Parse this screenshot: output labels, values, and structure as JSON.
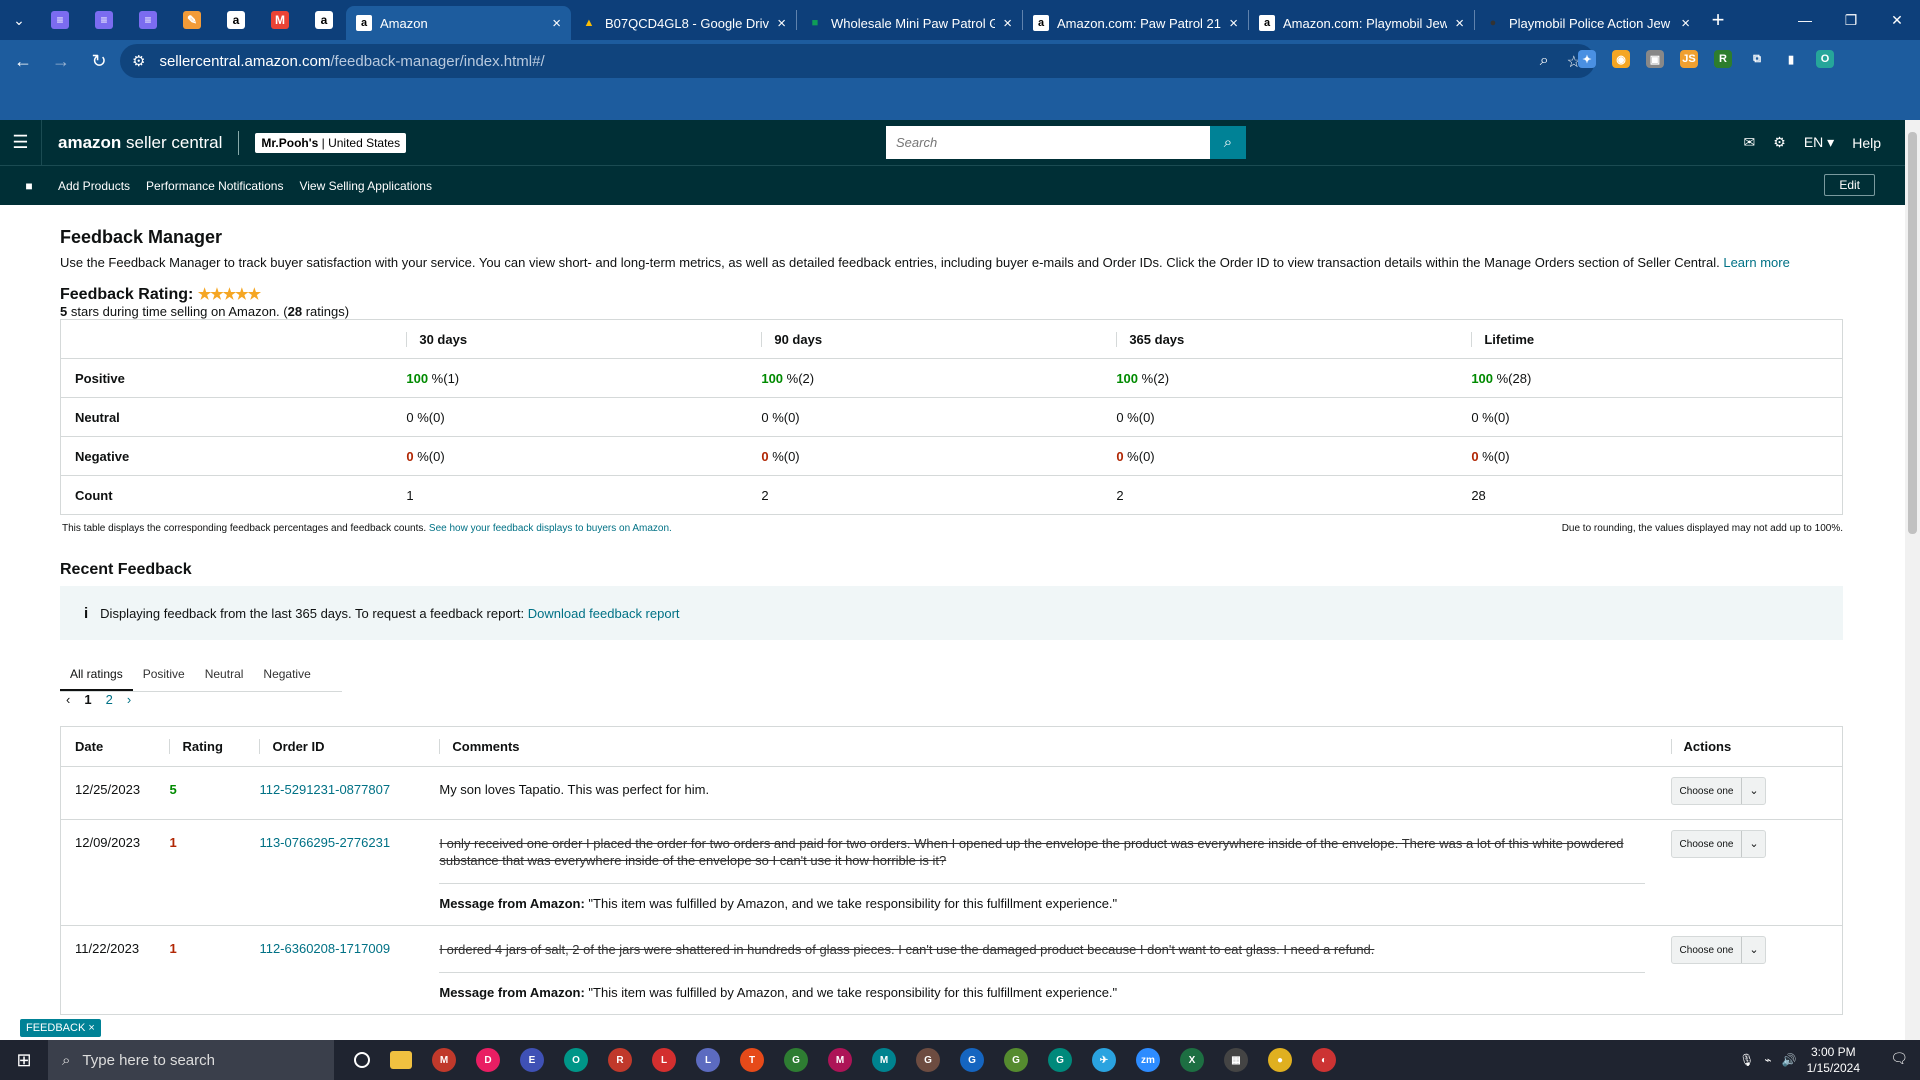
{
  "browser": {
    "pinned_tabs": [
      {
        "icon": "list-icon",
        "color": "#7b6cf0"
      },
      {
        "icon": "list-icon",
        "color": "#7b6cf0"
      },
      {
        "icon": "list-icon",
        "color": "#7b6cf0"
      },
      {
        "icon": "pen-icon",
        "color": "#f29b38"
      },
      {
        "icon": "amazon-icon",
        "color": "#ffffff"
      },
      {
        "icon": "gmail-icon",
        "color": "#ea4335"
      },
      {
        "icon": "amazon-icon",
        "color": "#ffffff"
      }
    ],
    "tabs": [
      {
        "title": "Amazon",
        "active": true,
        "favicon": "a",
        "color": "#ffffff"
      },
      {
        "title": "B07QCD4GL8 - Google Drive",
        "active": false,
        "favicon": "▲",
        "color": "#fbbc04"
      },
      {
        "title": "Wholesale Mini Paw Patrol G",
        "active": false,
        "favicon": "■",
        "color": "#0f9d58"
      },
      {
        "title": "Amazon.com: Paw Patrol 21\"",
        "active": false,
        "favicon": "a",
        "color": "#ffffff"
      },
      {
        "title": "Amazon.com: Playmobil Jew",
        "active": false,
        "favicon": "a",
        "color": "#ffffff"
      },
      {
        "title": "Playmobil Police Action Jew",
        "active": false,
        "favicon": "●",
        "color": "#333333"
      }
    ],
    "url_site": "sellercentral.amazon.com",
    "url_path": "/feedback-manager/index.html#/",
    "extensions": [
      {
        "icon": "puzzle-ext-icon",
        "color": "#4a90e2",
        "glyph": "✦"
      },
      {
        "icon": "orange-ext-icon",
        "color": "#f5a623",
        "glyph": "◉"
      },
      {
        "icon": "image-ext-icon",
        "color": "#888888",
        "glyph": "▣"
      },
      {
        "icon": "js-ext-icon",
        "color": "#f0a030",
        "glyph": "JS"
      },
      {
        "icon": "r-ext-icon",
        "color": "#2d7d2d",
        "glyph": "R"
      },
      {
        "icon": "extensions-icon",
        "color": "#1d5c9e",
        "glyph": "⧉"
      },
      {
        "icon": "sidepanel-icon",
        "color": "#1d5c9e",
        "glyph": "▮"
      },
      {
        "icon": "profile-icon",
        "color": "#26a69a",
        "glyph": "O"
      }
    ]
  },
  "sc": {
    "logo_bold": "amazon",
    "logo_rest": " seller central",
    "account_name": "Mr.Pooh's",
    "account_country": "United States",
    "search_placeholder": "Search",
    "lang": "EN ▾",
    "help": "Help",
    "nav": [
      "Add Products",
      "Performance Notifications",
      "View Selling Applications"
    ],
    "edit": "Edit"
  },
  "page": {
    "title": "Feedback Manager",
    "description": "Use the Feedback Manager to track buyer satisfaction with your service. You can view short- and long-term metrics, as well as detailed feedback entries, including buyer e-mails and Order IDs. Click the Order ID to view transaction details within the Manage Orders section of Seller Central.",
    "learn_more": "Learn more",
    "rating_label": "Feedback Rating:",
    "stars": "★★★★★",
    "rating_sub_bold": "5",
    "rating_sub_text": " stars during time selling on Amazon. (",
    "rating_count": "28",
    "rating_sub_end": " ratings)"
  },
  "metrics": {
    "headers": [
      "30 days",
      "90 days",
      "365 days",
      "Lifetime"
    ],
    "rows": [
      {
        "label": "Positive",
        "cls": "g",
        "cells": [
          [
            "100",
            " %(1)"
          ],
          [
            "100",
            " %(2)"
          ],
          [
            "100",
            " %(2)"
          ],
          [
            "100",
            " %(28)"
          ]
        ]
      },
      {
        "label": "Neutral",
        "cls": "",
        "cells": [
          [
            "0",
            " %(0)"
          ],
          [
            "0",
            " %(0)"
          ],
          [
            "0",
            " %(0)"
          ],
          [
            "0",
            " %(0)"
          ]
        ]
      },
      {
        "label": "Negative",
        "cls": "r",
        "cells": [
          [
            "0",
            " %(0)"
          ],
          [
            "0",
            " %(0)"
          ],
          [
            "0",
            " %(0)"
          ],
          [
            "0",
            " %(0)"
          ]
        ]
      },
      {
        "label": "Count",
        "cls": "",
        "cells": [
          [
            "",
            "1"
          ],
          [
            "",
            "2"
          ],
          [
            "",
            "2"
          ],
          [
            "",
            "28"
          ]
        ]
      }
    ],
    "note_left": "This table displays the corresponding feedback percentages and feedback counts.",
    "note_left_link": "See how your feedback displays to buyers on Amazon.",
    "note_right": "Due to rounding, the values displayed may not add up to 100%."
  },
  "recent": {
    "title": "Recent Feedback",
    "info_text": "Displaying feedback from the last 365 days. To request a feedback report:",
    "info_link": "Download feedback report",
    "tabs": [
      "All ratings",
      "Positive",
      "Neutral",
      "Negative"
    ],
    "pages": [
      "1",
      "2"
    ],
    "columns": [
      "Date",
      "Rating",
      "Order ID",
      "Comments",
      "Actions"
    ],
    "rows": [
      {
        "date": "12/25/2023",
        "rating": "5",
        "rating_cls": "g",
        "order": "112-5291231-0877807",
        "comment": "My son loves Tapatio. This was perfect for him.",
        "struck": false,
        "message": ""
      },
      {
        "date": "12/09/2023",
        "rating": "1",
        "rating_cls": "r",
        "order": "113-0766295-2776231",
        "comment": "I only received one order I placed the order for two orders and paid for two orders. When I opened up the envelope the product was everywhere inside of the envelope. There was a lot of this white powdered substance that was everywhere inside of the envelope so I can't use it how horrible is it?",
        "struck": true,
        "message": "\"This item was fulfilled by Amazon, and we take responsibility for this fulfillment experience.\""
      },
      {
        "date": "11/22/2023",
        "rating": "1",
        "rating_cls": "r",
        "order": "112-6360208-1717009",
        "comment": "I ordered 4 jars of salt, 2 of the jars were shattered in hundreds of glass pieces. I can't use the damaged product because I don't want to eat glass. I need a refund.",
        "struck": true,
        "message": "\"This item was fulfilled by Amazon, and we take responsibility for this fulfillment experience.\""
      }
    ],
    "message_label": "Message from Amazon:",
    "action_label": "Choose one"
  },
  "feedback_tag": "FEEDBACK ×",
  "taskbar": {
    "search": "Type here to search",
    "time": "3:00 PM",
    "date": "1/15/2024",
    "apps": [
      {
        "icon": "chrome-icon",
        "color": "#c0392b",
        "glyph": "M"
      },
      {
        "icon": "chrome-icon",
        "color": "#e91e63",
        "glyph": "D"
      },
      {
        "icon": "chrome-icon",
        "color": "#3f51b5",
        "glyph": "E"
      },
      {
        "icon": "chrome-icon",
        "color": "#009688",
        "glyph": "O"
      },
      {
        "icon": "chrome-icon",
        "color": "#c0392b",
        "glyph": "R"
      },
      {
        "icon": "chrome-icon",
        "color": "#d32f2f",
        "glyph": "L"
      },
      {
        "icon": "chrome-icon",
        "color": "#5c6bc0",
        "glyph": "L"
      },
      {
        "icon": "chrome-icon",
        "color": "#e64a19",
        "glyph": "T"
      },
      {
        "icon": "chrome-icon",
        "color": "#2e7d32",
        "glyph": "G"
      },
      {
        "icon": "chrome-icon",
        "color": "#ad1457",
        "glyph": "M"
      },
      {
        "icon": "chrome-icon",
        "color": "#00838f",
        "glyph": "M"
      },
      {
        "icon": "chrome-icon",
        "color": "#6d4c41",
        "glyph": "G"
      },
      {
        "icon": "chrome-icon",
        "color": "#1565c0",
        "glyph": "G"
      },
      {
        "icon": "chrome-icon",
        "color": "#558b2f",
        "glyph": "G"
      },
      {
        "icon": "chrome-icon",
        "color": "#00897b",
        "glyph": "G"
      },
      {
        "icon": "telegram-icon",
        "color": "#2aa3e0",
        "glyph": "✈"
      },
      {
        "icon": "zoom-icon",
        "color": "#2d8cff",
        "glyph": "zm"
      },
      {
        "icon": "excel-icon",
        "color": "#1d6f42",
        "glyph": "X"
      },
      {
        "icon": "calculator-icon",
        "color": "#444444",
        "glyph": "▦"
      },
      {
        "icon": "app-icon",
        "color": "#e0b020",
        "glyph": "●"
      },
      {
        "icon": "app-icon",
        "color": "#cc3333",
        "glyph": "◐"
      }
    ]
  }
}
